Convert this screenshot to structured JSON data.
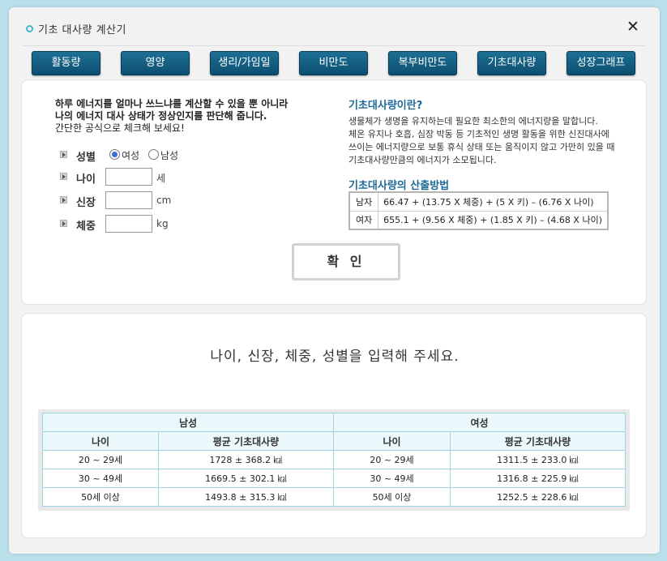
{
  "window": {
    "title": "기초 대사량 계산기",
    "close_label": "✕"
  },
  "tabs": [
    "활동량",
    "영양",
    "생리/가임일",
    "비만도",
    "복부비만도",
    "기초대사량",
    "성장그래프"
  ],
  "intro": {
    "line1": "하루 에너지를 얼마나 쓰느냐를 계산할 수 있을 뿐 아니라",
    "line2": "나의 에너지 대사 상태가 정상인지를 판단해 줍니다.",
    "line3": "간단한 공식으로 체크해 보세요!"
  },
  "form": {
    "gender_label": "성별",
    "gender_options": [
      "여성",
      "남성"
    ],
    "gender_selected": "여성",
    "age_label": "나이",
    "age_unit": "세",
    "age_value": "",
    "height_label": "신장",
    "height_unit": "cm",
    "height_value": "",
    "weight_label": "체중",
    "weight_unit": "kg",
    "weight_value": ""
  },
  "info": {
    "title": "기초대사량이란?",
    "lines": [
      "생물체가 생명을 유지하는데 필요한 최소한의 에너지량을 말합니다.",
      "체온 유지나 호흡, 심장 박동 등 기초적인 생명 활동을 위한 신진대사에",
      "쓰이는 에너지량으로 보통 휴식 상태 또는 움직이지 않고 가만히 있을 때",
      "기초대사량만큼의 에너지가 소모됩니다."
    ],
    "method_title": "기초대사량의 산출방법",
    "formulas": [
      {
        "gender": "남자",
        "formula": "66.47 + (13.75 X 체중) + (5 X 키) – (6.76 X 나이)"
      },
      {
        "gender": "여자",
        "formula": "655.1 + (9.56 X 체중) + (1.85 X 키) – (4.68 X 나이)"
      }
    ]
  },
  "confirm_label": "확 인",
  "result_message": "나이, 신장, 체중, 성별을 입력해 주세요.",
  "stats": {
    "male_header": "남성",
    "female_header": "여성",
    "col_age": "나이",
    "col_avg": "평균 기초대사량",
    "rows": [
      {
        "age": "20 ~ 29세",
        "male": "1728 ± 368.2 ㎉",
        "female": "1311.5 ± 233.0 ㎉"
      },
      {
        "age": "30 ~ 49세",
        "male": "1669.5 ± 302.1 ㎉",
        "female": "1316.8 ± 225.9 ㎉"
      },
      {
        "age": "50세 이상",
        "male": "1493.8 ± 315.3 ㎉",
        "female": "1252.5 ± 228.6 ㎉"
      }
    ]
  }
}
